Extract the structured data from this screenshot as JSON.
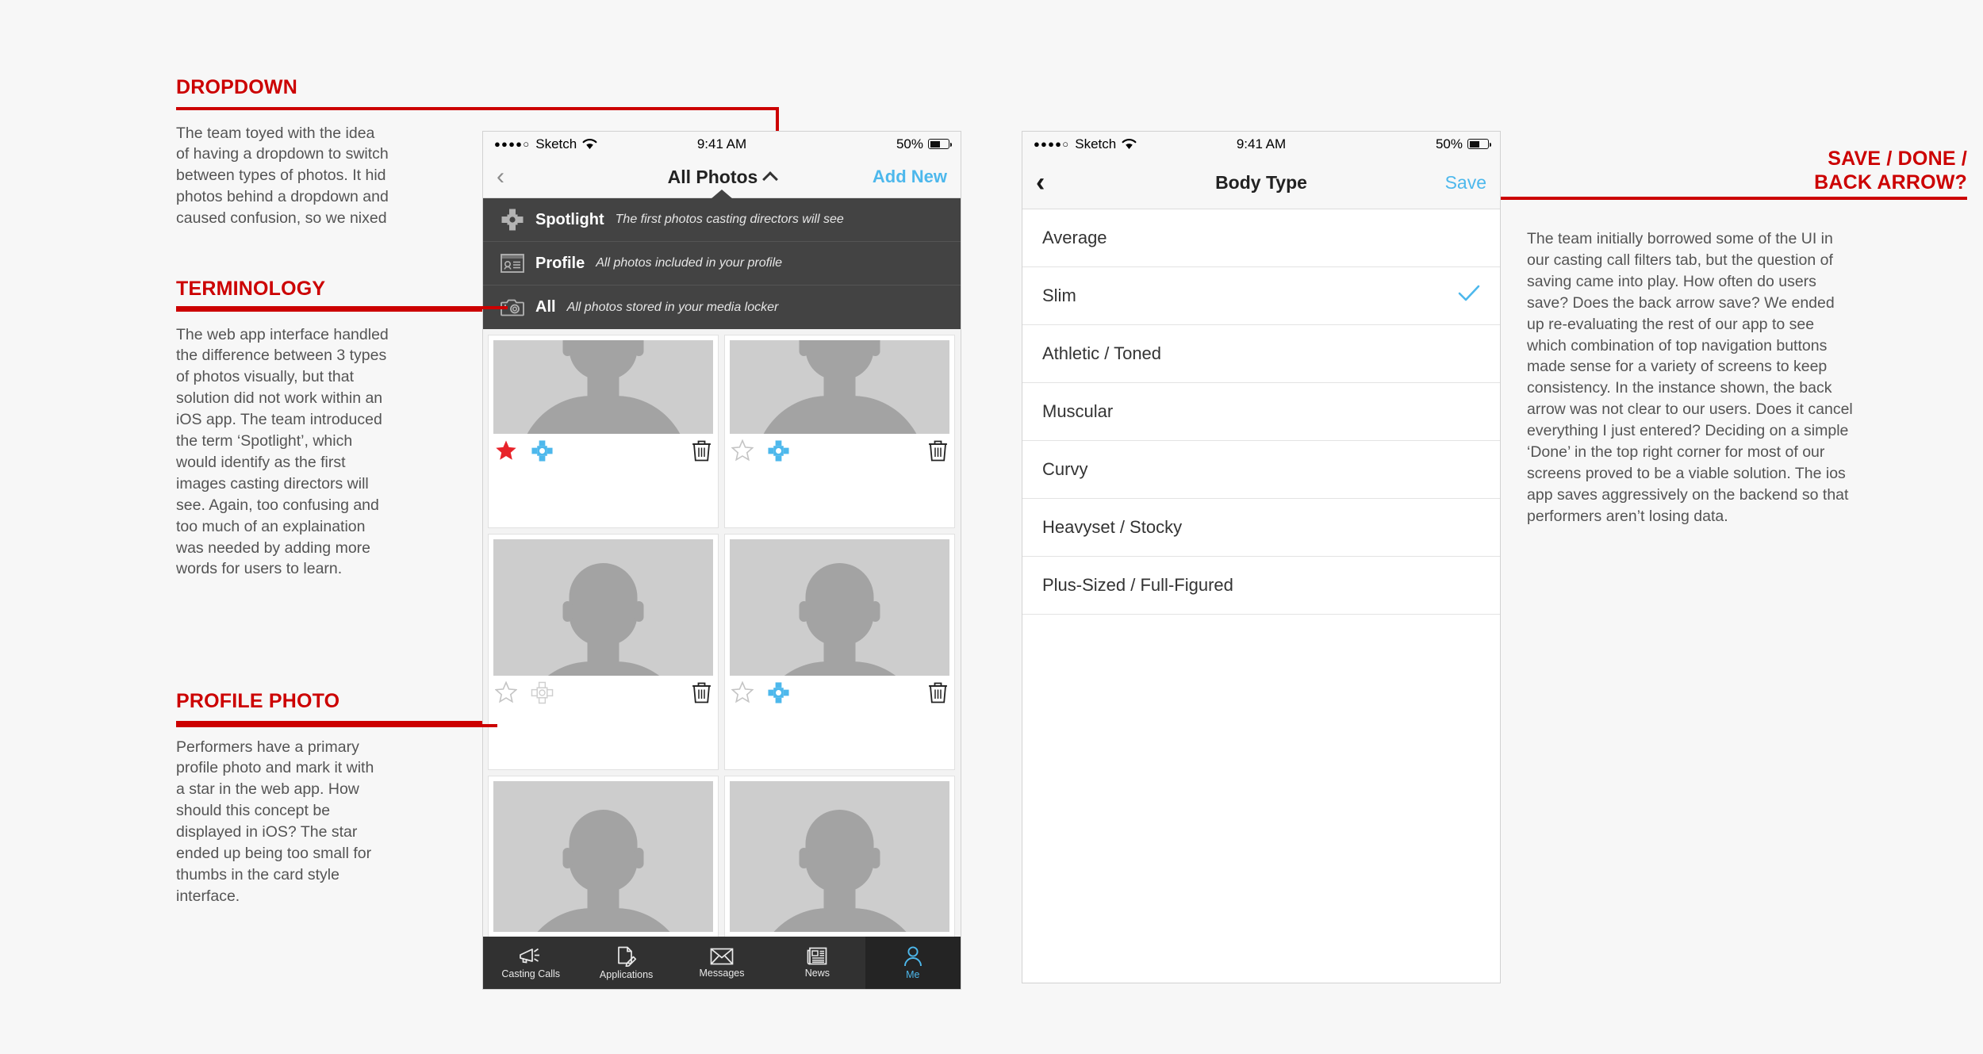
{
  "annotations": {
    "dropdown": {
      "title": "DROPDOWN",
      "body": "The team toyed with the idea of having a dropdown to switch between types of photos. It hid photos behind a dropdown and caused confusion, so we nixed this concept."
    },
    "terminology": {
      "title": "TERMINOLOGY",
      "body": "The web app interface handled the difference between 3 types of photos visually, but that solution did not work within an iOS app. The team introduced the term ‘Spotlight’, which would identify as the first images casting directors will see. Again, too confusing and too much of an explaination was needed by adding more words for users to learn."
    },
    "profile_photo": {
      "title": "PROFILE PHOTO",
      "body": "Performers have a primary profile photo and mark it with a star in the web app. How should this concept be displayed in iOS? The star ended up being too small for thumbs in the card style interface."
    },
    "save_done": {
      "title": "SAVE / DONE /\nBACK ARROW?",
      "body": "The team initially borrowed some of the UI in our casting call filters tab, but the question of saving came into play. How often do users save? Does the back arrow save? We ended up re-evaluating the rest of our app to see which combination of top navigation buttons made sense for a variety of screens to keep consistency. In the instance shown, the back arrow was not clear to our users. Does it cancel everything I just entered? Deciding on a simple ‘Done’ in the top right corner for most of our screens proved to be a viable solution. The ios app saves aggressively on the backend so that performers aren’t losing data."
    }
  },
  "colors": {
    "accent_red": "#cc0000",
    "ios_blue": "#4db8ec",
    "star_red": "#e8232a",
    "dropdown_bg": "#434343",
    "tabbar_bg": "#313131"
  },
  "phone_photos": {
    "status": {
      "signal_dots": "●●●●○",
      "carrier": "Sketch",
      "wifi_icon": "wifi-icon",
      "time": "9:41 AM",
      "battery_pct": "50%",
      "battery_level": 50
    },
    "nav": {
      "back_icon": "chevron-left-icon",
      "title": "All Photos",
      "title_chevron": "chevron-up-icon",
      "action_label": "Add New"
    },
    "dropdown_items": [
      {
        "icon": "spotlight-icon",
        "label": "Spotlight",
        "desc": "The first photos casting directors will see"
      },
      {
        "icon": "profile-card-icon",
        "label": "Profile",
        "desc": "All photos included in your profile"
      },
      {
        "icon": "camera-icon",
        "label": "All",
        "desc": "All photos stored in your media locker"
      }
    ],
    "cards": [
      {
        "starred": true,
        "spotlight": true,
        "delete_icon": "trash-icon"
      },
      {
        "starred": false,
        "spotlight": true,
        "delete_icon": "trash-icon"
      },
      {
        "starred": false,
        "spotlight": false,
        "delete_icon": "trash-icon"
      },
      {
        "starred": false,
        "spotlight": true,
        "delete_icon": "trash-icon"
      }
    ],
    "tabs": [
      {
        "icon": "megaphone-icon",
        "label": "Casting Calls",
        "active": false
      },
      {
        "icon": "document-pencil-icon",
        "label": "Applications",
        "active": false
      },
      {
        "icon": "envelope-icon",
        "label": "Messages",
        "active": false
      },
      {
        "icon": "newspaper-icon",
        "label": "News",
        "active": false
      },
      {
        "icon": "person-icon",
        "label": "Me",
        "active": true
      }
    ]
  },
  "phone_bodytype": {
    "status": {
      "signal_dots": "●●●●○",
      "carrier": "Sketch",
      "wifi_icon": "wifi-icon",
      "time": "9:41 AM",
      "battery_pct": "50%",
      "battery_level": 50
    },
    "nav": {
      "back_icon": "chevron-left-icon",
      "title": "Body Type",
      "action_label": "Save"
    },
    "options": [
      {
        "label": "Average",
        "selected": false
      },
      {
        "label": "Slim",
        "selected": true
      },
      {
        "label": "Athletic / Toned",
        "selected": false
      },
      {
        "label": "Muscular",
        "selected": false
      },
      {
        "label": "Curvy",
        "selected": false
      },
      {
        "label": "Heavyset / Stocky",
        "selected": false
      },
      {
        "label": "Plus-Sized / Full-Figured",
        "selected": false
      }
    ]
  }
}
